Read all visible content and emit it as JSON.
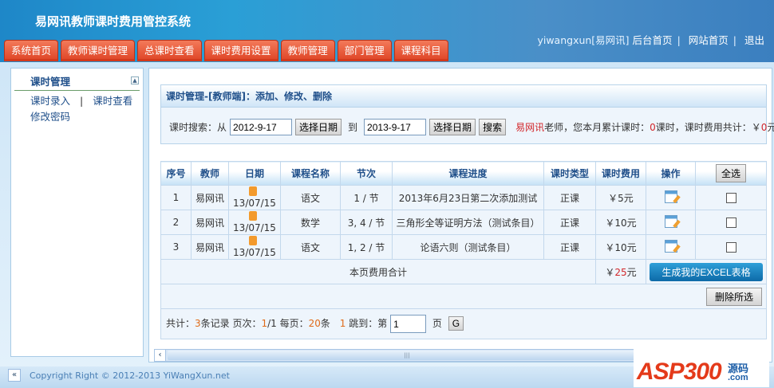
{
  "app": {
    "title": "易网讯教师课时费用管控系统"
  },
  "tabs": [
    "系统首页",
    "教师课时管理",
    "总课时查看",
    "课时费用设置",
    "教师管理",
    "部门管理",
    "课程科目"
  ],
  "user": {
    "name": "yiwangxun[易网讯]",
    "links": [
      "后台首页",
      "网站首页",
      "退出"
    ]
  },
  "sidebar": {
    "title": "课时管理",
    "links": [
      "课时录入",
      "课时查看",
      "修改密码"
    ],
    "sep": "|"
  },
  "panel": {
    "title": "课时管理-[教师端]：添加、修改、删除"
  },
  "search": {
    "label": "课时搜索：从",
    "from": "2012-9-17",
    "to_label": "到",
    "to": "2013-9-17",
    "pick": "选择日期",
    "search": "搜索",
    "teacher": "易网讯",
    "msg1": "老师，您本月累计课时：",
    "hours": "0",
    "msg2": "课时，课时费用共计：￥",
    "fee": "0",
    "msg3": "元"
  },
  "table": {
    "headers": [
      "序号",
      "教师",
      "日期",
      "课程名称",
      "节次",
      "课程进度",
      "课时类型",
      "课时费用",
      "操作"
    ],
    "select_all": "全选",
    "rows": [
      {
        "no": "1",
        "teacher": "易网讯",
        "date": "13/07/15",
        "course": "语文",
        "section": "1 / 节",
        "progress": "2013年6月23日第二次添加测试",
        "type": "正课",
        "fee": "￥5元"
      },
      {
        "no": "2",
        "teacher": "易网讯",
        "date": "13/07/15",
        "course": "数学",
        "section": "3, 4 / 节",
        "progress": "三角形全等证明方法（测试条目）",
        "type": "正课",
        "fee": "￥10元"
      },
      {
        "no": "3",
        "teacher": "易网讯",
        "date": "13/07/15",
        "course": "语文",
        "section": "1, 2 / 节",
        "progress": "论语六则（测试条目）",
        "type": "正课",
        "fee": "￥10元"
      }
    ],
    "total_label": "本页费用合计",
    "total_prefix": "￥",
    "total": "25",
    "total_suffix": "元",
    "excel": "生成我的EXCEL表格",
    "delete": "删除所选"
  },
  "pager": {
    "p1": "共计：",
    "count": "3",
    "p2": "条记录 页次：",
    "page": "1",
    "p3": "/1 每页：",
    "per": "20",
    "p4": "条",
    "cur": "1",
    "p5": "跳到：第",
    "input": "1",
    "p6": "页",
    "go": "G"
  },
  "footer": {
    "copyright": "Copyright Right © 2012-2013 YiWangXun.net"
  },
  "watermark": {
    "text": "ASP300",
    "cn": "源码",
    "com": ".com"
  }
}
